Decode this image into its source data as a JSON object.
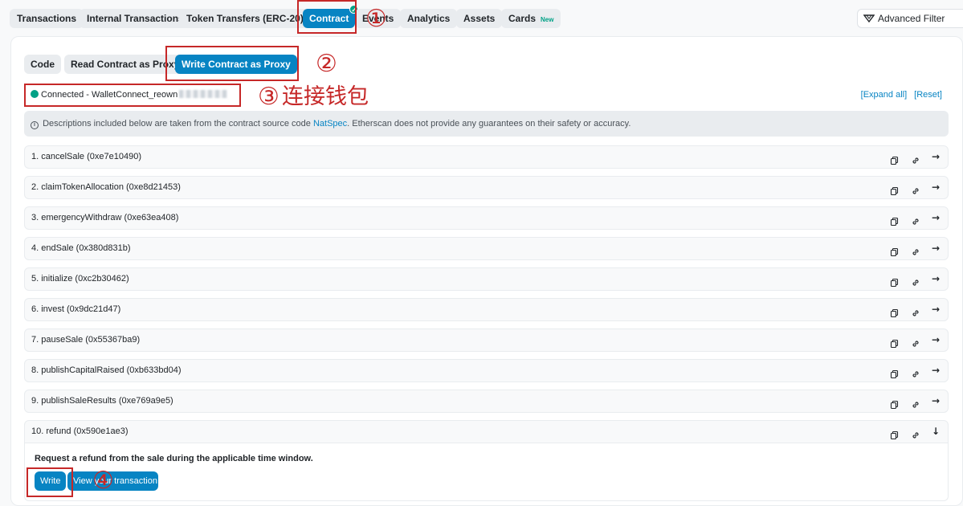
{
  "tabs": [
    {
      "label": "Transactions"
    },
    {
      "label": "Internal Transactions"
    },
    {
      "label": "Token Transfers (ERC-20)"
    },
    {
      "label": "Contract",
      "check_icon": "✓"
    },
    {
      "label": "Events"
    },
    {
      "label": "Analytics"
    },
    {
      "label": "Assets"
    },
    {
      "label": "Cards",
      "badge": "New"
    }
  ],
  "advanced_filter": {
    "label": "Advanced Filter",
    "icon": "filter-icon"
  },
  "subtabs": [
    {
      "label": "Code"
    },
    {
      "label": "Read Contract as Proxy"
    },
    {
      "label": "Write Contract as Proxy"
    }
  ],
  "connection": {
    "status": "Connected - WalletConnect_reown",
    "status_color": "#00a186"
  },
  "links": {
    "expand_all": "[Expand all]",
    "reset": "[Reset]"
  },
  "notice": {
    "info_icon": "i",
    "prefix": "Descriptions included below are taken from the contract source code ",
    "link": "NatSpec",
    "suffix": ". Etherscan does not provide any guarantees on their safety or accuracy."
  },
  "functions": [
    {
      "label": "1. cancelSale (0xe7e10490)",
      "arrow": "→"
    },
    {
      "label": "2. claimTokenAllocation (0xe8d21453)",
      "arrow": "→"
    },
    {
      "label": "3. emergencyWithdraw (0xe63ea408)",
      "arrow": "→"
    },
    {
      "label": "4. endSale (0x380d831b)",
      "arrow": "→"
    },
    {
      "label": "5. initialize (0xc2b30462)",
      "arrow": "→"
    },
    {
      "label": "6. invest (0x9dc21d47)",
      "arrow": "→"
    },
    {
      "label": "7. pauseSale (0x55367ba9)",
      "arrow": "→"
    },
    {
      "label": "8. publishCapitalRaised (0xb633bd04)",
      "arrow": "→"
    },
    {
      "label": "9. publishSaleResults (0xe769a9e5)",
      "arrow": "→"
    },
    {
      "label": "10. refund (0x590e1ae3)",
      "arrow": "↓"
    }
  ],
  "expanded": {
    "description": "Request a refund from the sale during the applicable time window.",
    "write_label": "Write",
    "view_label": "View your transaction"
  },
  "annotations": {
    "n1": "①",
    "n2": "②",
    "n3": "③",
    "n3_text": "连接钱包",
    "n4": "④"
  },
  "colors": {
    "accent": "#0784c3",
    "success": "#00a186",
    "annotation": "#c62828"
  }
}
